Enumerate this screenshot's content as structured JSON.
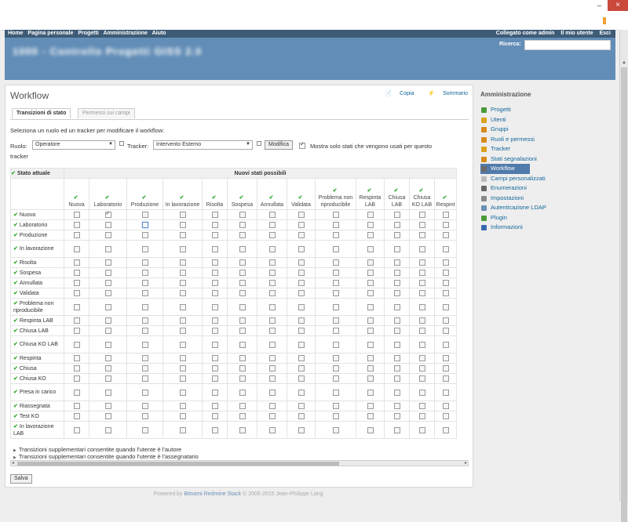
{
  "top_menu": {
    "left": [
      "Home",
      "Pagina personale",
      "Progetti",
      "Amministrazione",
      "Aiuto"
    ],
    "logged_as": "Collegato come admin",
    "my_account": "Il mio utente",
    "logout": "Esci"
  },
  "header": {
    "title": "1000 - Controllo Progetti GISS 2.0",
    "search_label": "Ricerca:"
  },
  "page": {
    "title": "Workflow",
    "copy": "Copia",
    "summary": "Sommario"
  },
  "tabs": [
    "Transizioni di stato",
    "Permessi sui campi"
  ],
  "instructions": "Seleziona un ruolo ed un tracker per modificare il workflow:",
  "filter": {
    "role_label": "Ruolo:",
    "role_value": "Operatore",
    "tracker_label": "Tracker:",
    "tracker_value": "Intervento Esterno",
    "button": "Modifica",
    "only_used_line1": "Mostra solo stati che vengono usati per questo",
    "only_used_line2": "tracker"
  },
  "table": {
    "current_status_header": "Stato attuale",
    "new_status_header": "Nuovi stati possibili",
    "columns": [
      "Nuova",
      "Laboratorio",
      "Produzione",
      "In lavorazione",
      "Risolta",
      "Sospesa",
      "Annullata",
      "Validata",
      "Problema non riproducibile",
      "Respinta LAB",
      "Chiusa LAB",
      "Chiusa KO LAB",
      "Respint"
    ],
    "rows": [
      "Nuova",
      "Laboratorio",
      "Produzione",
      "In lavorazione",
      "Risolta",
      "Sospesa",
      "Annullata",
      "Validata",
      "Problema non riproducibile",
      "Respinta LAB",
      "Chiusa LAB",
      "Chiusa KO LAB",
      "Respinta",
      "Chiusa",
      "Chiusa KO",
      "Presa in carico",
      "Riassegnata",
      "Test KO",
      "In lavorazione LAB"
    ],
    "checked": [
      [
        0,
        1
      ]
    ],
    "focused": [
      [
        1,
        2
      ]
    ]
  },
  "summaries": [
    "Transizioni supplementari consentite quando l'utente è l'autore",
    "Transizioni supplementari consentite quando l'utente è l'assegnatario"
  ],
  "save_label": "Salva",
  "footer": {
    "prefix": "Powered by ",
    "link": "Bitnami Redmine Stack",
    "suffix": " © 2006-2015 Jean-Philippe Lang"
  },
  "sidebar": {
    "title": "Amministrazione",
    "items": [
      {
        "label": "Progetti",
        "icon": "projects-icon"
      },
      {
        "label": "Utenti",
        "icon": "user-icon"
      },
      {
        "label": "Gruppi",
        "icon": "group-icon"
      },
      {
        "label": "Ruoli e permessi",
        "icon": "roles-icon"
      },
      {
        "label": "Tracker",
        "icon": "tracker-icon"
      },
      {
        "label": "Stati segnalazioni",
        "icon": "status-icon"
      },
      {
        "label": "Workflow",
        "icon": "workflow-icon",
        "selected": true
      },
      {
        "label": "Campi personalizzati",
        "icon": "custom-fields-icon"
      },
      {
        "label": "Enumerazioni",
        "icon": "list-icon"
      },
      {
        "label": "Impostazioni",
        "icon": "settings-icon"
      },
      {
        "label": "Autenticazione LDAP",
        "icon": "ldap-icon"
      },
      {
        "label": "Plugin",
        "icon": "plugin-icon"
      },
      {
        "label": "Informazioni",
        "icon": "info-icon"
      }
    ]
  },
  "colors": {
    "header": "#628db6",
    "top_menu": "#3e5b76",
    "link": "#169",
    "selected": "#507aaa"
  }
}
